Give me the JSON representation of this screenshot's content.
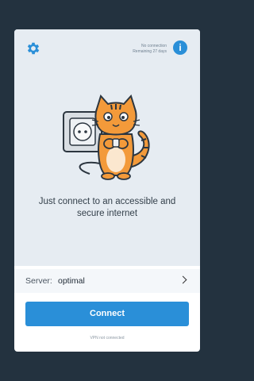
{
  "header": {
    "status_line1": "No connection",
    "status_line2": "Remaining 27 days",
    "info_label": "i"
  },
  "main": {
    "tagline_line1": "Just connect to an accessible and",
    "tagline_line2": "secure internet"
  },
  "server": {
    "label": "Server:",
    "value": "optimal"
  },
  "connect_button": {
    "label": "Connect"
  },
  "footer": {
    "vpn_status": "VPN not connected"
  },
  "icons": {
    "settings": "gear-icon",
    "info": "info-icon",
    "server_arrow": "chevron-right-icon",
    "illustration": "cat-with-plug-illustration"
  },
  "colors": {
    "accent": "#2a8fd8",
    "background": "#23323f",
    "panel": "#e6ecf2",
    "cat": "#f39a3a"
  }
}
